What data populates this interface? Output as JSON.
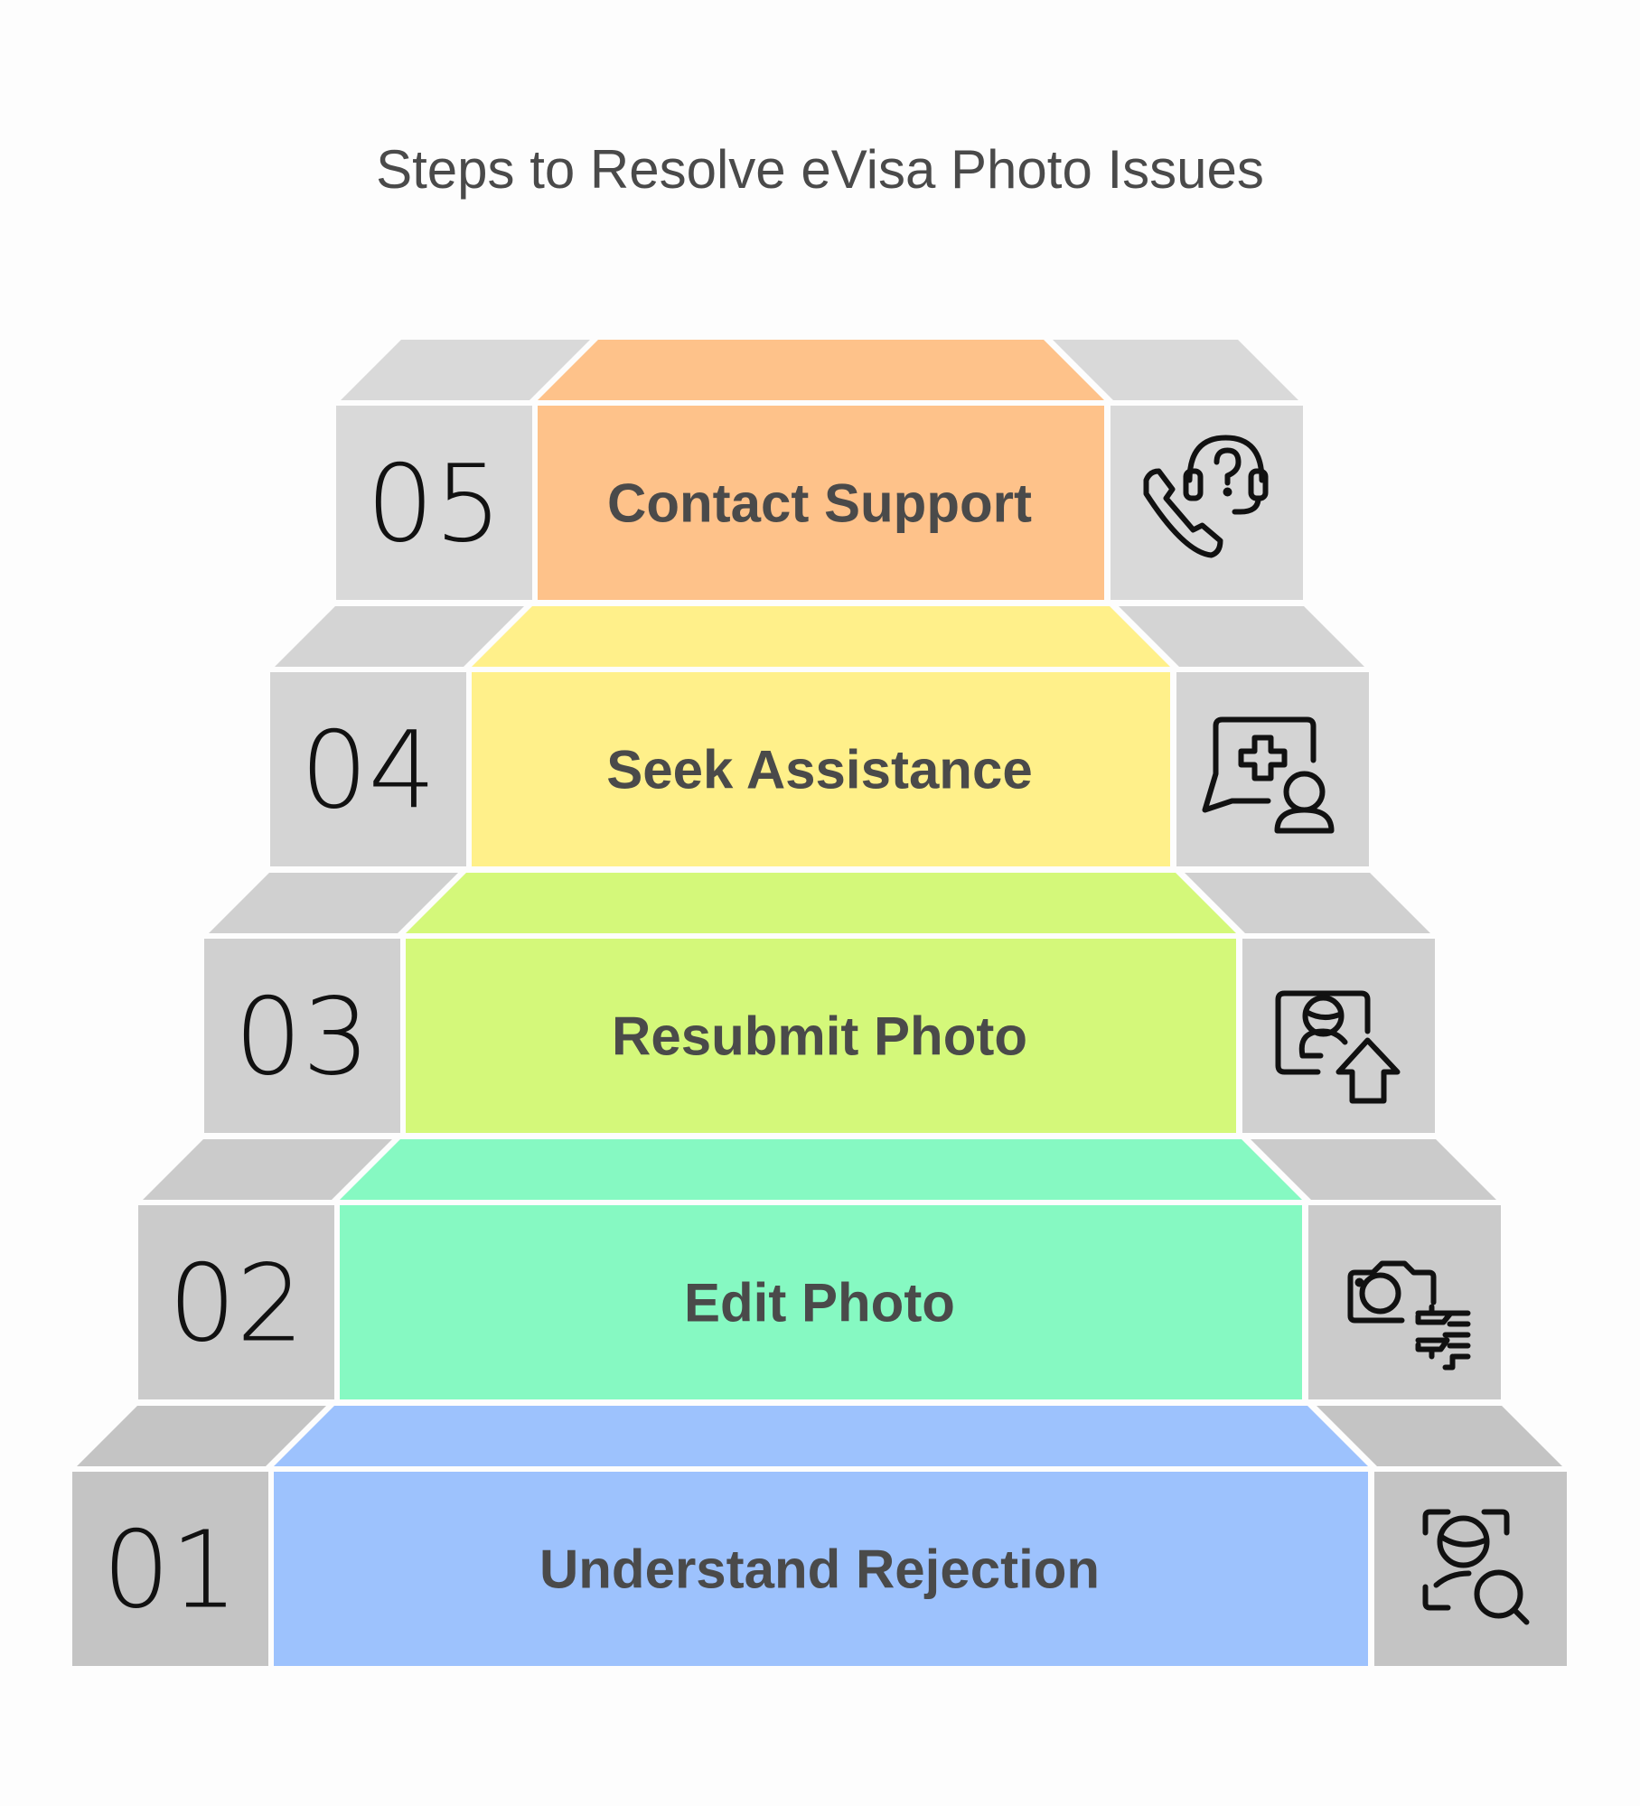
{
  "title": "Steps to Resolve eVisa Photo Issues",
  "steps": [
    {
      "number": "01",
      "label": "Understand Rejection",
      "icon": "face-scan-search-icon",
      "color": "#9dc2fd",
      "gray": "#c4c4c4"
    },
    {
      "number": "02",
      "label": "Edit Photo",
      "icon": "camera-edit-icon",
      "color": "#86f9c2",
      "gray": "#cbcbcb"
    },
    {
      "number": "03",
      "label": "Resubmit Photo",
      "icon": "photo-upload-icon",
      "color": "#d4f87a",
      "gray": "#d0d0d0"
    },
    {
      "number": "04",
      "label": "Seek Assistance",
      "icon": "medical-chat-person-icon",
      "color": "#fff08a",
      "gray": "#d4d4d4"
    },
    {
      "number": "05",
      "label": "Contact Support",
      "icon": "phone-headset-help-icon",
      "color": "#fec28a",
      "gray": "#d9d9d9"
    }
  ]
}
